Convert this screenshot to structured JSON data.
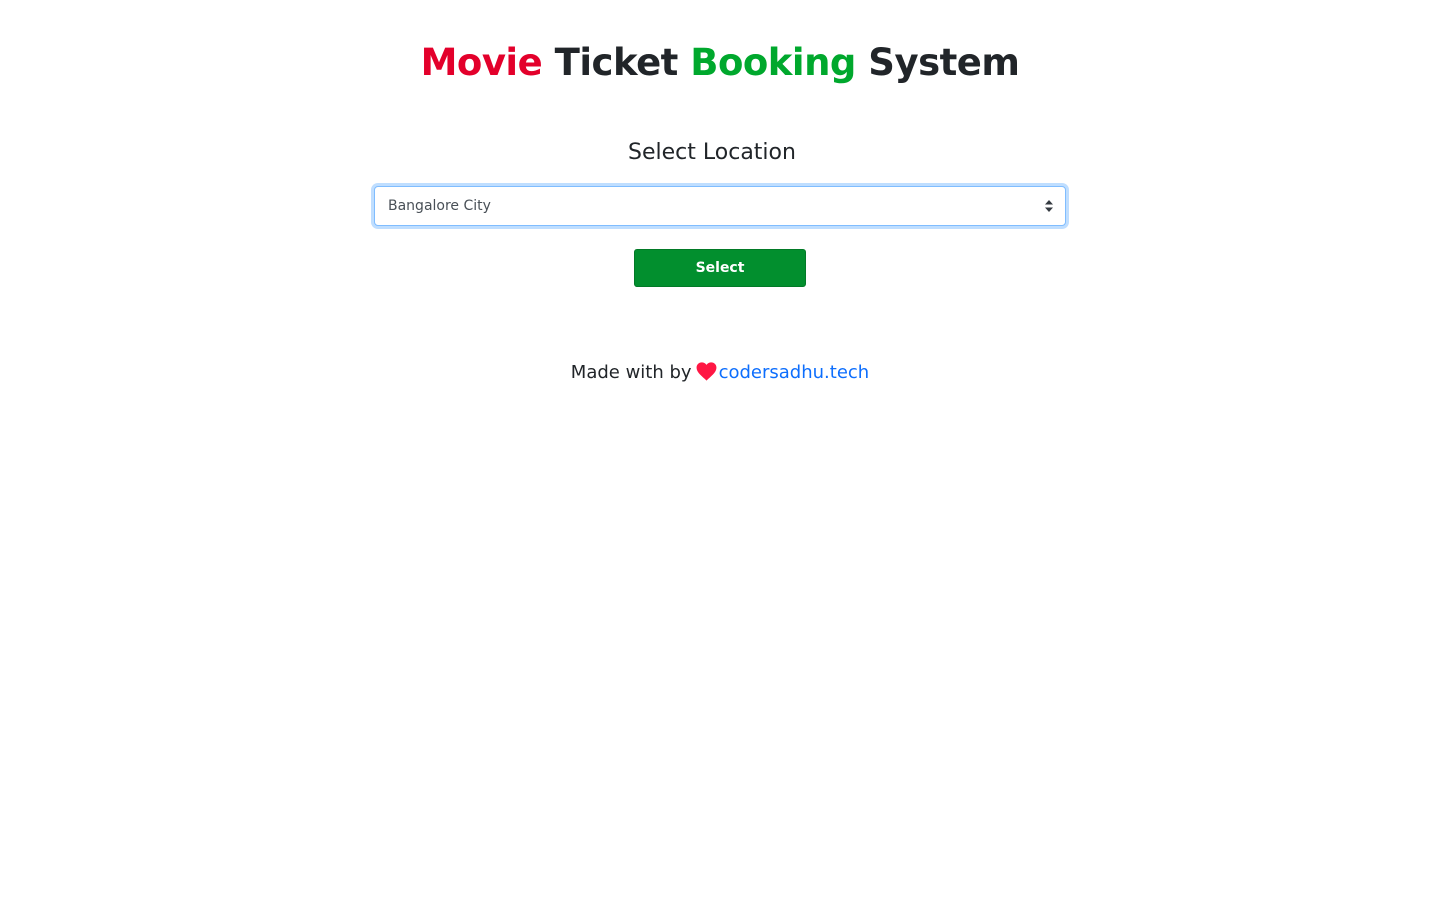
{
  "header": {
    "title_words": [
      {
        "text": "Movie",
        "color": "#e3002b"
      },
      {
        "text": "Ticket",
        "color": "#212529"
      },
      {
        "text": "Booking",
        "color": "#00a82d"
      },
      {
        "text": "System",
        "color": "#212529"
      }
    ]
  },
  "location": {
    "heading": "Select Location",
    "selected_value": "Bangalore City",
    "caret_icon": "select-caret-icon"
  },
  "actions": {
    "select_label": "Select",
    "select_color": "#028f2e"
  },
  "footer": {
    "prefix": "Made with by",
    "icon": "heart-icon",
    "icon_color": "#ff1744",
    "link_text": "codersadhu.tech",
    "link_color": "#0d6efd"
  }
}
